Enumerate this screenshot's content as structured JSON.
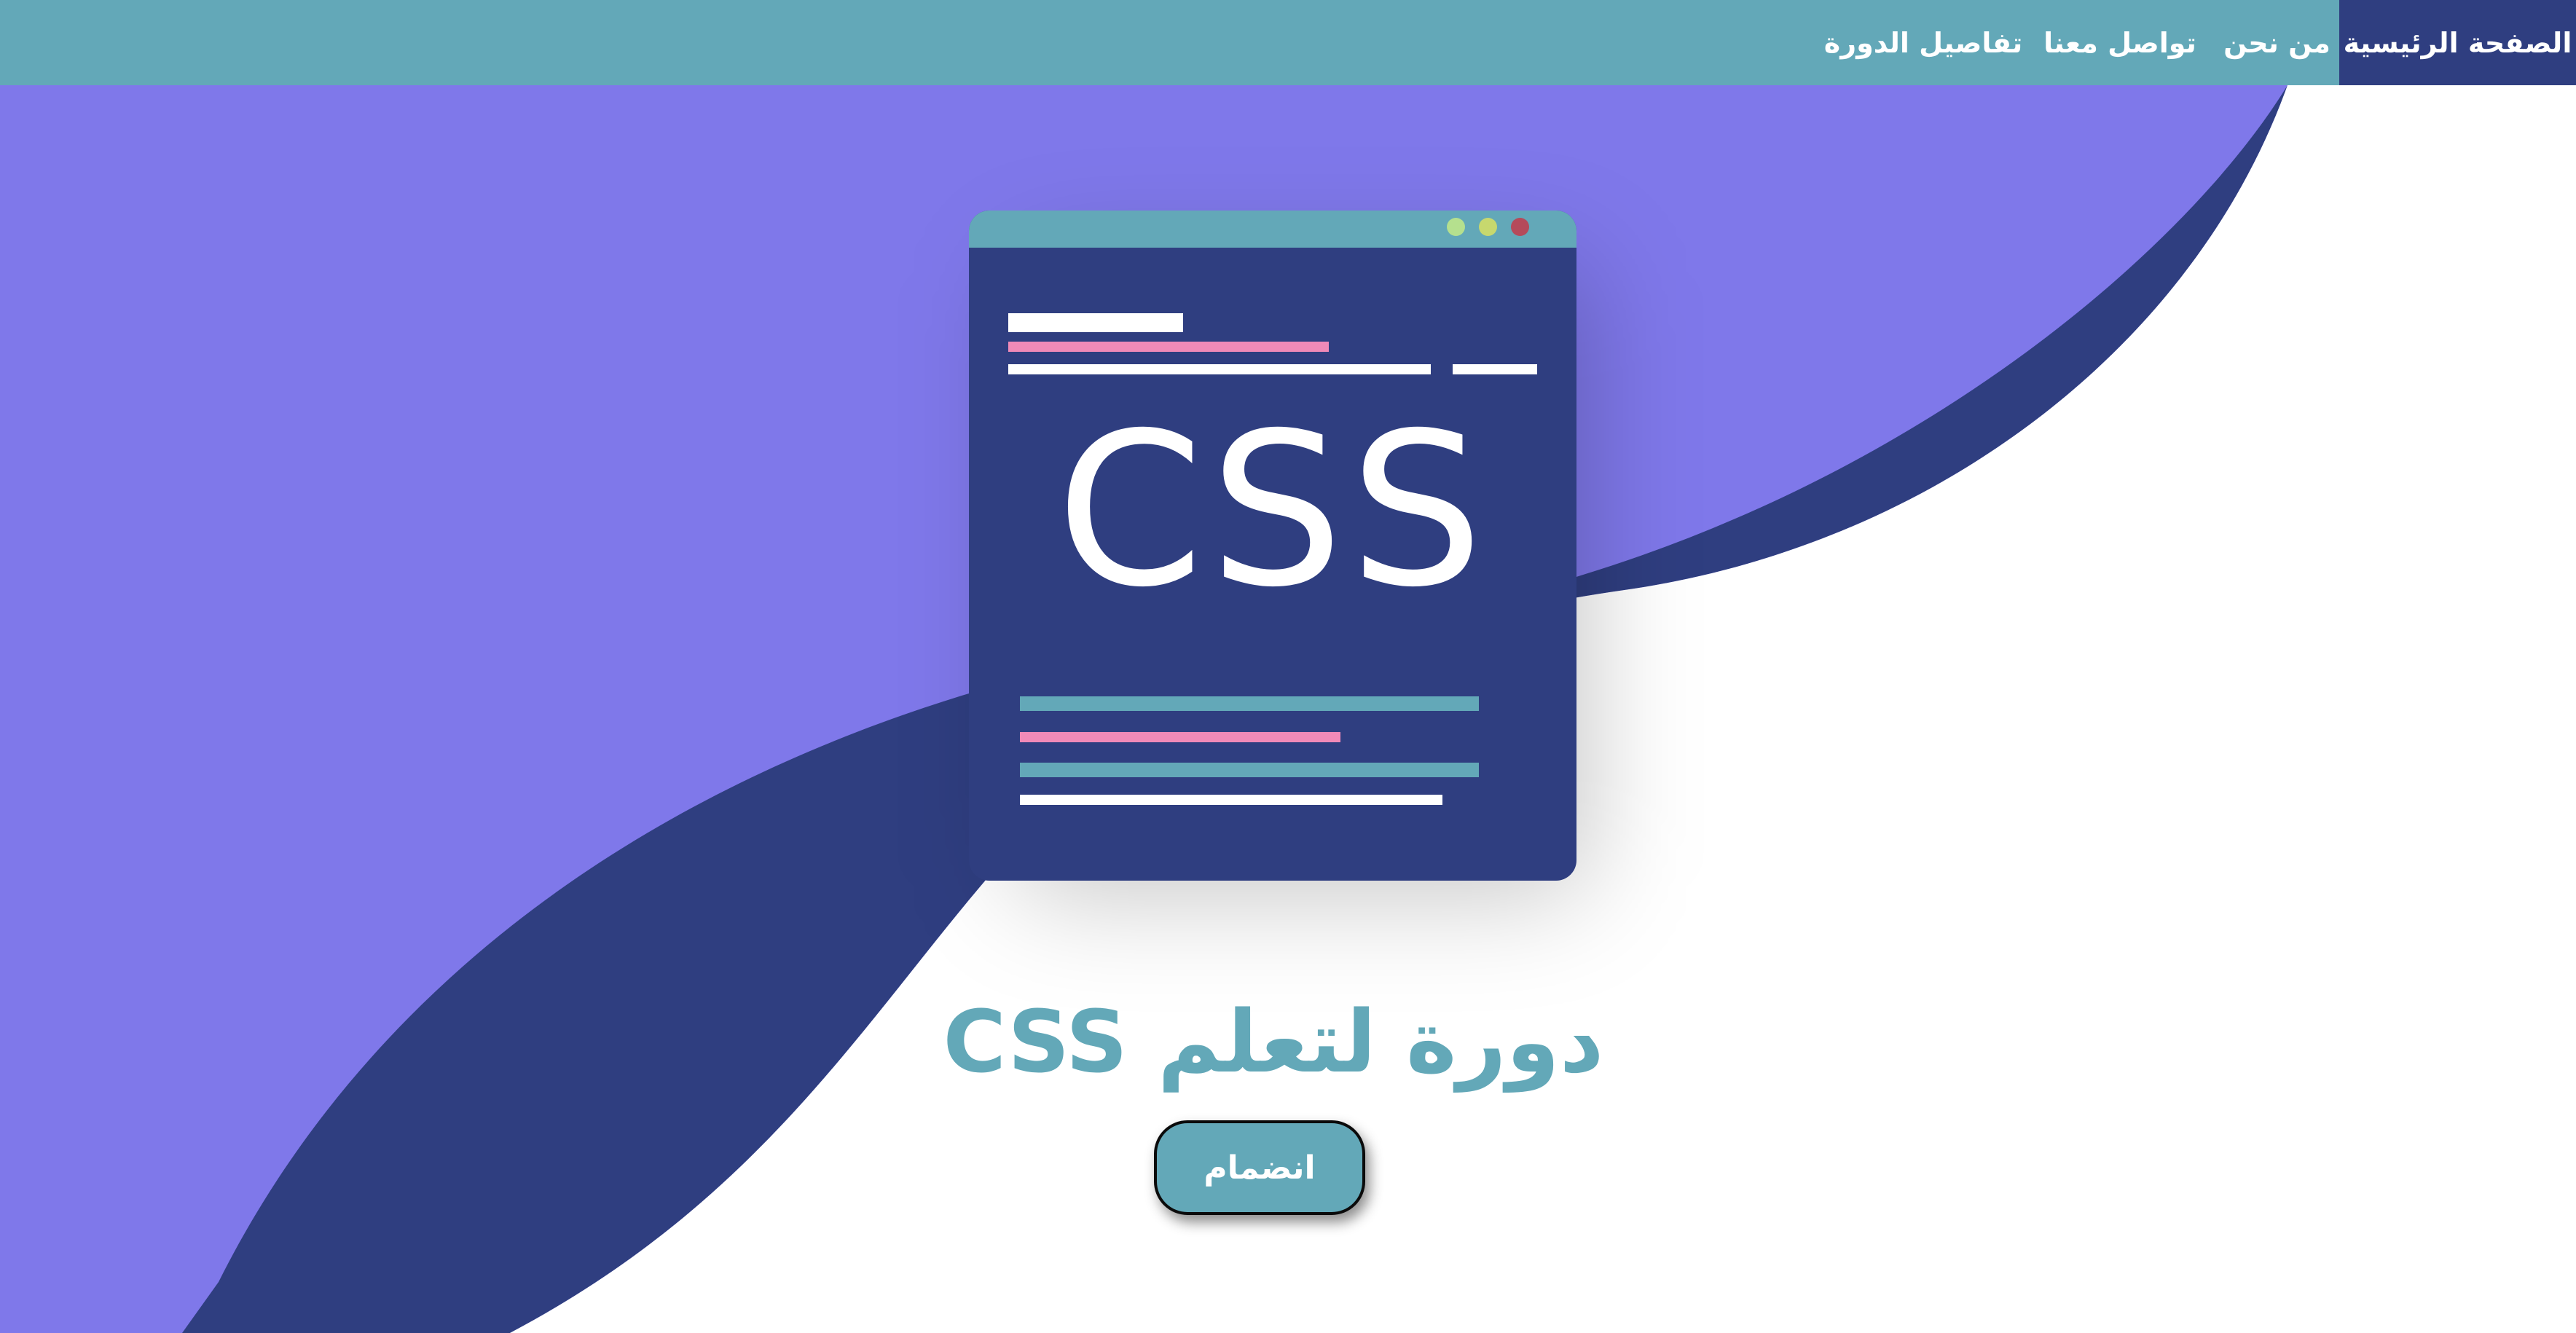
{
  "nav": {
    "items": [
      {
        "label": "الصفحة الرئيسية",
        "active": true
      },
      {
        "label": "من نحن",
        "active": false
      },
      {
        "label": "تواصل معنا",
        "active": false
      },
      {
        "label": "تفاصيل الدورة",
        "active": false
      }
    ]
  },
  "hero": {
    "illustration_text": "CSS",
    "title": "دورة لتعلم CSS",
    "button_label": "انضمام"
  },
  "colors": {
    "nav_background": "#63a8b8",
    "nav_active": "#2f3e80",
    "purple_background": "#7f78ea",
    "dark_wave": "#2f3e80",
    "accent": "#63a8b8",
    "pink": "#f08ab8"
  },
  "icons": {
    "window_controls": [
      "green-dot-icon",
      "yellow-dot-icon",
      "red-dot-icon"
    ]
  }
}
